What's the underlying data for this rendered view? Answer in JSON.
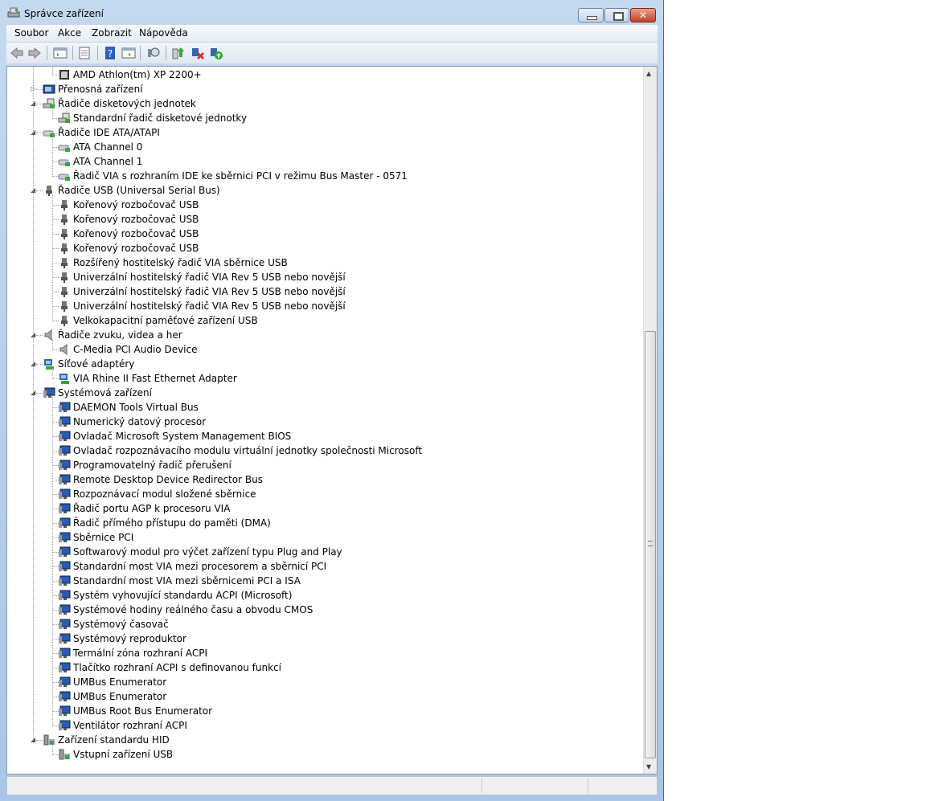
{
  "window": {
    "title": "Správce zařízení",
    "close": "✕"
  },
  "menu": [
    "Soubor",
    "Akce",
    "Zobrazit",
    "Nápověda"
  ],
  "toolbar": [
    "back-icon",
    "forward-icon",
    "show-hide-console-tree-icon",
    "properties-icon",
    "help-icon",
    "show-action-pane-icon",
    "scan-hardware-icon",
    "update-driver-icon",
    "uninstall-icon",
    "enable-device-icon"
  ],
  "colors": {
    "accent": "#2a6ab8",
    "closeButton": "#c0402c"
  },
  "tree": [
    {
      "level": 1,
      "icon": "cpu",
      "label": "AMD Athlon(tm) XP 2200+"
    },
    {
      "level": 0,
      "exp": "closed",
      "icon": "portable",
      "label": "Přenosná zařízení"
    },
    {
      "level": 0,
      "exp": "open",
      "icon": "floppy",
      "label": "Řadiče disketových jednotek"
    },
    {
      "level": 1,
      "icon": "floppy",
      "label": "Standardní řadič disketové jednotky"
    },
    {
      "level": 0,
      "exp": "open",
      "icon": "ide",
      "label": "Řadiče IDE ATA/ATAPI"
    },
    {
      "level": 1,
      "icon": "ide",
      "label": "ATA Channel 0"
    },
    {
      "level": 1,
      "icon": "ide",
      "label": "ATA Channel 1"
    },
    {
      "level": 1,
      "icon": "ide",
      "label": "Řadič VIA s rozhraním IDE ke sběrnici PCI v režimu Bus Master - 0571"
    },
    {
      "level": 0,
      "exp": "open",
      "icon": "usb",
      "label": "Řadiče USB (Universal Serial Bus)"
    },
    {
      "level": 1,
      "icon": "usb",
      "label": "Kořenový rozbočovač USB"
    },
    {
      "level": 1,
      "icon": "usb",
      "label": "Kořenový rozbočovač USB"
    },
    {
      "level": 1,
      "icon": "usb",
      "label": "Kořenový rozbočovač USB"
    },
    {
      "level": 1,
      "icon": "usb",
      "label": "Kořenový rozbočovač USB"
    },
    {
      "level": 1,
      "icon": "usb",
      "label": "Rozšířený hostitelský řadič VIA sběrnice USB"
    },
    {
      "level": 1,
      "icon": "usb",
      "label": "Univerzální hostitelský řadič VIA Rev 5 USB nebo novější"
    },
    {
      "level": 1,
      "icon": "usb",
      "label": "Univerzální hostitelský řadič VIA Rev 5 USB nebo novější"
    },
    {
      "level": 1,
      "icon": "usb",
      "label": "Univerzální hostitelský řadič VIA Rev 5 USB nebo novější"
    },
    {
      "level": 1,
      "icon": "usb",
      "label": "Velkokapacitní paměťové zařízení USB"
    },
    {
      "level": 0,
      "exp": "open",
      "icon": "sound",
      "label": "Řadiče zvuku, videa a her"
    },
    {
      "level": 1,
      "icon": "sound",
      "label": "C-Media PCI Audio Device"
    },
    {
      "level": 0,
      "exp": "open",
      "icon": "net",
      "label": "Síťové adaptéry"
    },
    {
      "level": 1,
      "icon": "net",
      "label": "VIA Rhine II Fast Ethernet Adapter"
    },
    {
      "level": 0,
      "exp": "open",
      "icon": "sys",
      "label": "Systémová zařízení"
    },
    {
      "level": 1,
      "icon": "sys",
      "label": "DAEMON Tools Virtual Bus"
    },
    {
      "level": 1,
      "icon": "sys",
      "label": "Numerický datový procesor"
    },
    {
      "level": 1,
      "icon": "sys",
      "label": "Ovladač Microsoft System Management BIOS"
    },
    {
      "level": 1,
      "icon": "sys",
      "label": "Ovladač rozpoznávacího modulu virtuální jednotky společnosti Microsoft"
    },
    {
      "level": 1,
      "icon": "sys",
      "label": "Programovatelný řadič přerušení"
    },
    {
      "level": 1,
      "icon": "sys",
      "label": "Remote Desktop Device Redirector Bus"
    },
    {
      "level": 1,
      "icon": "sys",
      "label": "Rozpoznávací modul složené sběrnice"
    },
    {
      "level": 1,
      "icon": "sys",
      "label": "Řadič portu AGP k procesoru VIA"
    },
    {
      "level": 1,
      "icon": "sys",
      "label": "Řadič přímého přístupu do paměti (DMA)"
    },
    {
      "level": 1,
      "icon": "sys",
      "label": "Sběrnice PCI"
    },
    {
      "level": 1,
      "icon": "sys",
      "label": "Softwarový modul pro výčet zařízení typu Plug and Play"
    },
    {
      "level": 1,
      "icon": "sys",
      "label": "Standardní most VIA mezi procesorem a sběrnicí PCI"
    },
    {
      "level": 1,
      "icon": "sys",
      "label": "Standardní most VIA mezi sběrnicemi PCI a ISA"
    },
    {
      "level": 1,
      "icon": "sys",
      "label": "Systém vyhovující standardu ACPI (Microsoft)"
    },
    {
      "level": 1,
      "icon": "sys",
      "label": "Systémové hodiny reálného času a obvodu CMOS"
    },
    {
      "level": 1,
      "icon": "sys",
      "label": "Systémový časovač"
    },
    {
      "level": 1,
      "icon": "sys",
      "label": "Systémový reproduktor"
    },
    {
      "level": 1,
      "icon": "sys",
      "label": "Termální zóna rozhraní ACPI"
    },
    {
      "level": 1,
      "icon": "sys",
      "label": "Tlačítko rozhraní ACPI s definovanou funkcí"
    },
    {
      "level": 1,
      "icon": "sys",
      "label": "UMBus Enumerator"
    },
    {
      "level": 1,
      "icon": "sys",
      "label": "UMBus Enumerator"
    },
    {
      "level": 1,
      "icon": "sys",
      "label": "UMBus Root Bus Enumerator"
    },
    {
      "level": 1,
      "icon": "sys",
      "label": "Ventilátor rozhraní ACPI"
    },
    {
      "level": 0,
      "exp": "open",
      "icon": "hid",
      "label": "Zařízení standardu HID"
    },
    {
      "level": 1,
      "icon": "hid",
      "label": "Vstupní zařízení USB"
    }
  ]
}
